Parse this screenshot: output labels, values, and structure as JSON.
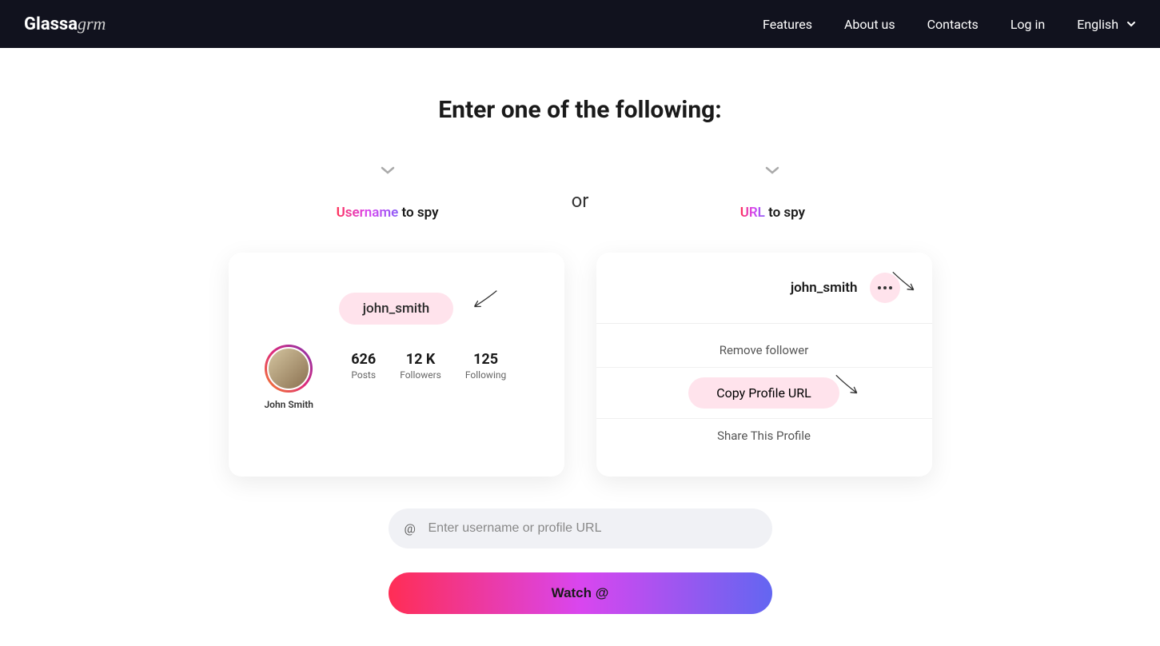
{
  "header": {
    "logo_prefix": "Glassa",
    "logo_suffix": "grm",
    "nav": {
      "features": "Features",
      "about": "About us",
      "contacts": "Contacts",
      "login": "Log in",
      "language": "English"
    }
  },
  "main": {
    "heading": "Enter one of the following:",
    "or_text": "or",
    "option1": {
      "highlight": "Username",
      "suffix": " to spy"
    },
    "option2": {
      "highlight": "URL",
      "suffix": " to spy"
    }
  },
  "card1": {
    "username": "john_smith",
    "display_name": "John Smith",
    "stats": {
      "posts": {
        "num": "626",
        "label": "Posts"
      },
      "followers": {
        "num": "12 K",
        "label": "Followers"
      },
      "following": {
        "num": "125",
        "label": "Following"
      }
    }
  },
  "card2": {
    "username": "john_smith",
    "menu": {
      "remove": "Remove follower",
      "copy": "Copy Profile URL",
      "share": "Share This Profile"
    }
  },
  "input": {
    "placeholder": "Enter username or profile URL"
  },
  "watch_button": "Watch @"
}
